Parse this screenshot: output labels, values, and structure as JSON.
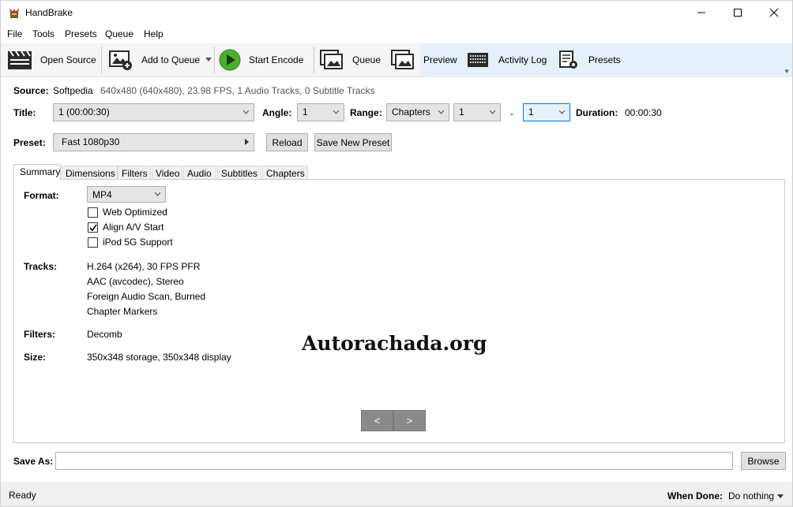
{
  "window": {
    "title": "HandBrake"
  },
  "menu": [
    "File",
    "Tools",
    "Presets",
    "Queue",
    "Help"
  ],
  "toolbar": {
    "open_source": "Open Source",
    "add_to_queue": "Add to Queue",
    "start_encode": "Start Encode",
    "queue": "Queue",
    "preview": "Preview",
    "activity_log": "Activity Log",
    "presets": "Presets"
  },
  "source": {
    "label": "Source:",
    "name": "Softpedia",
    "info": "640x480 (640x480), 23.98 FPS, 1 Audio Tracks, 0 Subtitle Tracks"
  },
  "title_row": {
    "title_label": "Title:",
    "title_value": "1  (00:00:30)",
    "angle_label": "Angle:",
    "angle_value": "1",
    "range_label": "Range:",
    "range_mode": "Chapters",
    "range_start": "1",
    "range_dash": "-",
    "range_end": "1",
    "duration_label": "Duration:",
    "duration_value": "00:00:30"
  },
  "preset_row": {
    "label": "Preset:",
    "value": "Fast 1080p30",
    "reload": "Reload",
    "save_new": "Save New Preset"
  },
  "tabs": [
    "Summary",
    "Dimensions",
    "Filters",
    "Video",
    "Audio",
    "Subtitles",
    "Chapters"
  ],
  "summary": {
    "format_label": "Format:",
    "format_value": "MP4",
    "web_optimized": "Web Optimized",
    "align_av": "Align A/V Start",
    "ipod": "iPod 5G Support",
    "tracks_label": "Tracks:",
    "tracks": [
      "H.264 (x264), 30 FPS PFR",
      "AAC (avcodec), Stereo",
      "Foreign Audio Scan, Burned",
      "Chapter Markers"
    ],
    "filters_label": "Filters:",
    "filters_value": "Decomb",
    "size_label": "Size:",
    "size_value": "350x348 storage, 350x348 display",
    "prev": "<",
    "next": ">"
  },
  "checkboxes": {
    "web_optimized": false,
    "align_av": true,
    "ipod": false
  },
  "watermark": "Autorachada.org",
  "save_as": {
    "label": "Save As:",
    "value": "",
    "browse": "Browse"
  },
  "status": {
    "text": "Ready",
    "when_done_label": "When Done:",
    "when_done_value": "Do nothing"
  }
}
